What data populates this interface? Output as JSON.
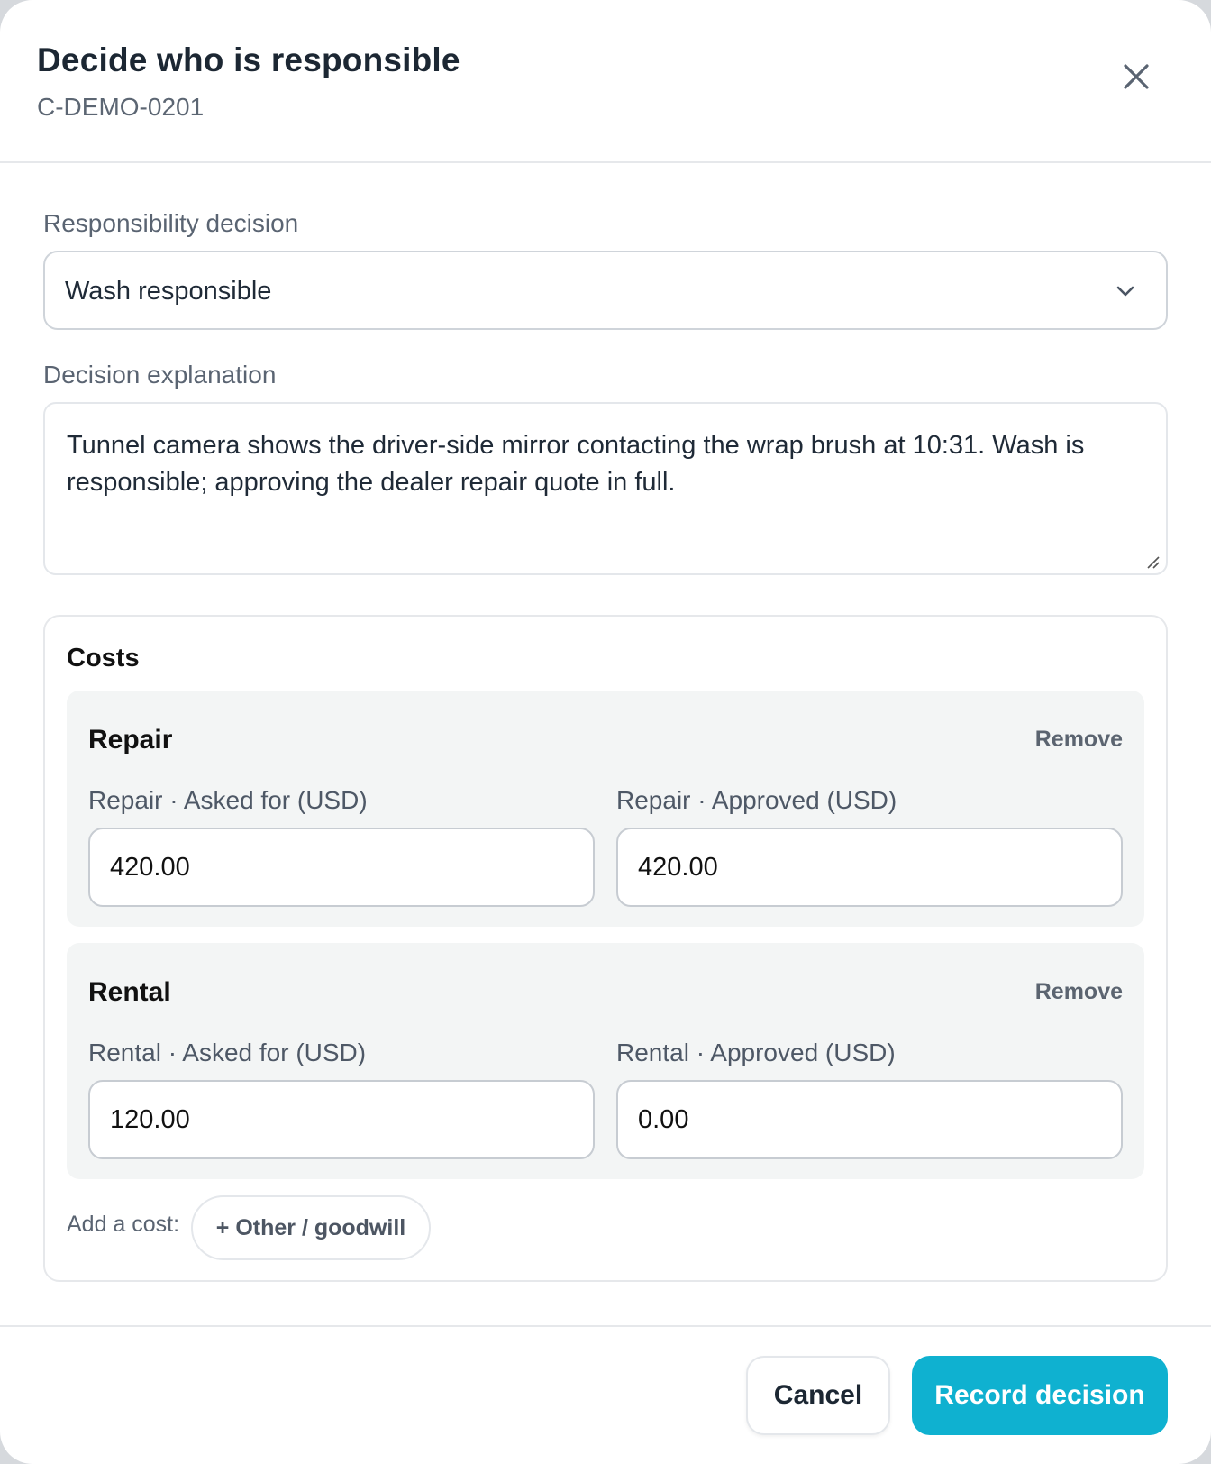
{
  "modal": {
    "title": "Decide who is responsible",
    "subtitle": "C-DEMO-0201",
    "close_icon": "close-icon"
  },
  "responsibility": {
    "label": "Responsibility decision",
    "selected": "Wash responsible",
    "icon": "chevron-down-icon"
  },
  "explanation": {
    "label": "Decision explanation",
    "value": "Tunnel camera shows the driver-side mirror contacting the wrap brush at 10:31. Wash is responsible; approving the dealer repair quote in full."
  },
  "costs": {
    "title": "Costs",
    "items": [
      {
        "name": "Repair",
        "remove_label": "Remove",
        "asked_label": "Repair · Asked for (USD)",
        "asked_value": "420.00",
        "approved_label": "Repair · Approved (USD)",
        "approved_value": "420.00"
      },
      {
        "name": "Rental",
        "remove_label": "Remove",
        "asked_label": "Rental · Asked for (USD)",
        "asked_value": "120.00",
        "approved_label": "Rental · Approved (USD)",
        "approved_value": "0.00"
      }
    ],
    "add_label": "Add a cost:",
    "add_button": "+ Other / goodwill"
  },
  "footer": {
    "cancel_label": "Cancel",
    "submit_label": "Record decision"
  },
  "colors": {
    "accent": "#0fb1d0",
    "title_text": "#1c2733",
    "muted_text": "#5a6472",
    "cost_block_bg": "#f3f5f5"
  }
}
